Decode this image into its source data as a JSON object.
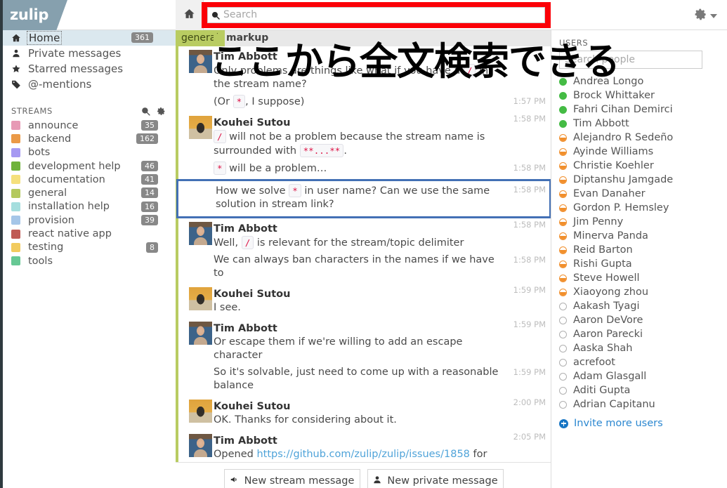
{
  "app": {
    "logo": "zulip"
  },
  "topbar": {
    "home_icon": "home-icon",
    "search_placeholder": "Search",
    "search_value": "",
    "gear_icon": "gear-icon"
  },
  "annotation": {
    "text": "ここから全文検索できる"
  },
  "sidebar": {
    "nav": [
      {
        "label": "Home",
        "count": "361",
        "icon": "home-icon",
        "active": true
      },
      {
        "label": "Private messages",
        "count": "",
        "icon": "person-icon",
        "active": false
      },
      {
        "label": "Starred messages",
        "count": "",
        "icon": "star-icon",
        "active": false
      },
      {
        "label": "@-mentions",
        "count": "",
        "icon": "tag-icon",
        "active": false
      }
    ],
    "streams_header": "STREAMS",
    "streams_search_icon": "search-icon",
    "streams_gear_icon": "gear-icon",
    "streams": [
      {
        "name": "announce",
        "count": "35",
        "color": "#e79ab5"
      },
      {
        "name": "backend",
        "count": "162",
        "color": "#eb9a47"
      },
      {
        "name": "bots",
        "count": "",
        "color": "#a699f2"
      },
      {
        "name": "development help",
        "count": "46",
        "color": "#6fb33b"
      },
      {
        "name": "documentation",
        "count": "41",
        "color": "#f5e07c"
      },
      {
        "name": "general",
        "count": "14",
        "color": "#b4c95e"
      },
      {
        "name": "installation help",
        "count": "16",
        "color": "#a5dede"
      },
      {
        "name": "provision",
        "count": "39",
        "color": "#a5c6e8"
      },
      {
        "name": "react native app",
        "count": "",
        "color": "#bf5b55"
      },
      {
        "name": "testing",
        "count": "8",
        "color": "#f2cb5e"
      },
      {
        "name": "tools",
        "count": "",
        "color": "#67c894"
      }
    ]
  },
  "center": {
    "stream_tag": "general",
    "topic": "markup",
    "messages": [
      {
        "sender": "Tim Abbott",
        "avatar": "av-tim",
        "show_header": true,
        "time": "",
        "parts": [
          {
            "t": "text",
            "v": "Only problems are things like what if you have a "
          },
          {
            "t": "code",
            "v": "/"
          },
          {
            "t": "text",
            "v": " in the stream name?"
          }
        ],
        "selected": false
      },
      {
        "sender": "",
        "avatar": "",
        "show_header": false,
        "time": "1:57 PM",
        "parts": [
          {
            "t": "text",
            "v": "(Or "
          },
          {
            "t": "code",
            "v": "*"
          },
          {
            "t": "text",
            "v": ", I suppose)"
          }
        ],
        "selected": false
      },
      {
        "sender": "Kouhei Sutou",
        "avatar": "av-kou",
        "show_header": true,
        "time": "1:58 PM",
        "parts": [
          {
            "t": "code",
            "v": "/"
          },
          {
            "t": "text",
            "v": " will not be a problem because the stream name is surrounded with "
          },
          {
            "t": "code",
            "v": "**...**"
          },
          {
            "t": "text",
            "v": "."
          }
        ],
        "selected": false
      },
      {
        "sender": "",
        "avatar": "",
        "show_header": false,
        "time": "1:58 PM",
        "parts": [
          {
            "t": "code",
            "v": "*"
          },
          {
            "t": "text",
            "v": " will be a problem…"
          }
        ],
        "selected": false
      },
      {
        "sender": "",
        "avatar": "",
        "show_header": false,
        "time": "1:58 PM",
        "parts": [
          {
            "t": "text",
            "v": "How we solve "
          },
          {
            "t": "code",
            "v": "*"
          },
          {
            "t": "text",
            "v": " in user name? Can we use the same solution in stream link?"
          }
        ],
        "selected": true
      },
      {
        "sender": "Tim Abbott",
        "avatar": "av-tim",
        "show_header": true,
        "time": "1:58 PM",
        "parts": [
          {
            "t": "text",
            "v": "Well, "
          },
          {
            "t": "code",
            "v": "/"
          },
          {
            "t": "text",
            "v": " is relevant for the stream/topic delimiter"
          }
        ],
        "selected": false
      },
      {
        "sender": "",
        "avatar": "",
        "show_header": false,
        "time": "1:58 PM",
        "parts": [
          {
            "t": "text",
            "v": "We can always ban characters in the names if we have to"
          }
        ],
        "selected": false
      },
      {
        "sender": "Kouhei Sutou",
        "avatar": "av-kou",
        "show_header": true,
        "time": "1:59 PM",
        "parts": [
          {
            "t": "text",
            "v": "I see."
          }
        ],
        "selected": false
      },
      {
        "sender": "Tim Abbott",
        "avatar": "av-tim",
        "show_header": true,
        "time": "1:59 PM",
        "parts": [
          {
            "t": "text",
            "v": "Or escape them if we're willing to add an escape character"
          }
        ],
        "selected": false
      },
      {
        "sender": "",
        "avatar": "",
        "show_header": false,
        "time": "1:59 PM",
        "parts": [
          {
            "t": "text",
            "v": "So it's solvable, just need to come up with a reasonable balance"
          }
        ],
        "selected": false
      },
      {
        "sender": "Kouhei Sutou",
        "avatar": "av-kou",
        "show_header": true,
        "time": "2:00 PM",
        "parts": [
          {
            "t": "text",
            "v": "OK. Thanks for considering about it."
          }
        ],
        "selected": false
      },
      {
        "sender": "Tim Abbott",
        "avatar": "av-tim",
        "show_header": true,
        "time": "2:05 PM",
        "parts": [
          {
            "t": "text",
            "v": "Opened "
          },
          {
            "t": "link",
            "v": "https://github.com/zulip/zulip/issues/1858"
          },
          {
            "t": "text",
            "v": " for this issue; feedback from other folks (or volunteers to work on it) are super welcome!"
          }
        ],
        "selected": false
      }
    ],
    "compose": {
      "stream_button": "New stream message",
      "private_button": "New private message"
    }
  },
  "right_sidebar": {
    "title": "USERS",
    "search_placeholder": "Search people",
    "search_value": "",
    "users": [
      {
        "name": "Andrea Longo",
        "status": "active"
      },
      {
        "name": "Brock Whittaker",
        "status": "active"
      },
      {
        "name": "Fahri Cihan Demirci",
        "status": "active"
      },
      {
        "name": "Tim Abbott",
        "status": "active"
      },
      {
        "name": "Alejandro R Sedeño",
        "status": "idle"
      },
      {
        "name": "Ayinde Williams",
        "status": "idle"
      },
      {
        "name": "Christie Koehler",
        "status": "idle"
      },
      {
        "name": "Diptanshu Jamgade",
        "status": "idle"
      },
      {
        "name": "Evan Danaher",
        "status": "idle"
      },
      {
        "name": "Gordon P. Hemsley",
        "status": "idle"
      },
      {
        "name": "Jim Penny",
        "status": "idle"
      },
      {
        "name": "Minerva Panda",
        "status": "idle"
      },
      {
        "name": "Reid Barton",
        "status": "idle"
      },
      {
        "name": "Rishi Gupta",
        "status": "idle"
      },
      {
        "name": "Steve Howell",
        "status": "idle"
      },
      {
        "name": "Xiaoyong zhou",
        "status": "idle"
      },
      {
        "name": "Aakash Tyagi",
        "status": "offline"
      },
      {
        "name": "Aaron DeVore",
        "status": "offline"
      },
      {
        "name": "Aaron Parecki",
        "status": "offline"
      },
      {
        "name": "Aaska Shah",
        "status": "offline"
      },
      {
        "name": "acrefoot",
        "status": "offline"
      },
      {
        "name": "Adam Glasgall",
        "status": "offline"
      },
      {
        "name": "Aditi Gupta",
        "status": "offline"
      },
      {
        "name": "Adrian Capitanu",
        "status": "offline"
      }
    ],
    "invite_label": "Invite more users"
  },
  "colors": {
    "brand": "#86a0ae",
    "stream_accent": "#b9cc62",
    "annotation_red": "#fb0007",
    "selection_blue": "#4370b5",
    "link_blue": "#4fa3d9"
  }
}
